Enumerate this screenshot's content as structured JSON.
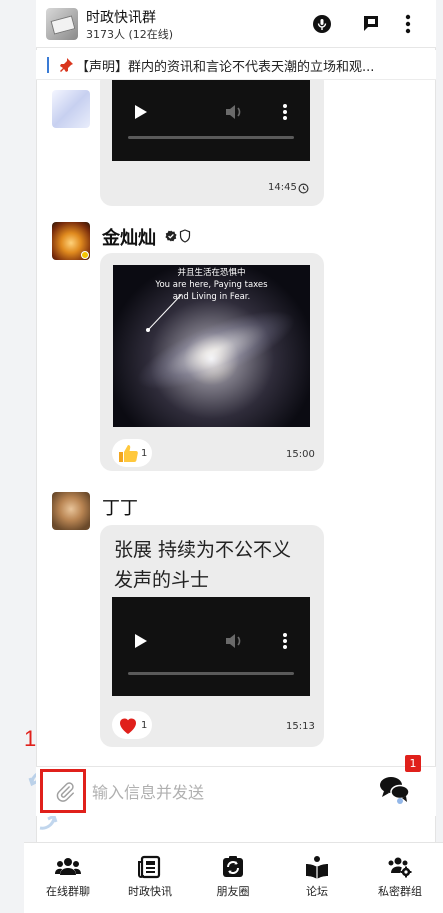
{
  "header": {
    "title": "时政快讯群",
    "subtitle": "3173人 (12在线)",
    "icons": [
      "podcast-icon",
      "flag-icon",
      "more-vert-icon"
    ]
  },
  "notice": {
    "icon": "pin-icon",
    "text": "【声明】群内的资讯和言论不代表天潮的立场和观..."
  },
  "messages": [
    {
      "type": "video",
      "time": "14:45",
      "status_icon": "clock-icon"
    },
    {
      "type": "image",
      "sender": "金灿灿",
      "sender_icons": [
        "verified-icon",
        "shield-icon"
      ],
      "image_caption_lines": [
        "并且生活在恐惧中",
        "You are here, Paying taxes",
        "and Living in Fear."
      ],
      "reaction": {
        "icon": "thumbs-up-icon",
        "count": "1"
      },
      "time": "15:00"
    },
    {
      "type": "text-video",
      "sender": "丁丁",
      "text": "张展 持续为不公不义发声的斗士",
      "reaction": {
        "icon": "heart-icon",
        "count": "1"
      },
      "time": "15:13"
    }
  ],
  "annotation": {
    "label": "1"
  },
  "input": {
    "placeholder": "输入信息并发送",
    "attach_icon": "paperclip-icon",
    "chat_icon": "chat-bubbles-icon",
    "badge": "1"
  },
  "bottom_nav": [
    {
      "icon": "group-icon",
      "label": "在线群聊"
    },
    {
      "icon": "news-icon",
      "label": "时政快讯"
    },
    {
      "icon": "moments-icon",
      "label": "朋友圈"
    },
    {
      "icon": "forum-icon",
      "label": "论坛"
    },
    {
      "icon": "private-group-icon",
      "label": "私密群组"
    }
  ],
  "colors": {
    "accent_red": "#e0201b",
    "bubble": "#ececec",
    "video_bg": "#111111"
  }
}
